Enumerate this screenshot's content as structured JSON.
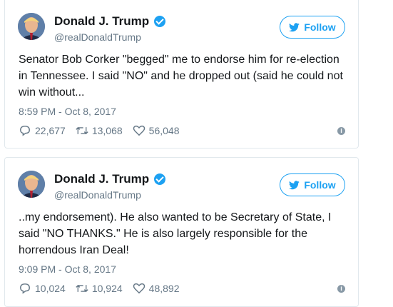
{
  "tweets": [
    {
      "author_name": "Donald J. Trump",
      "handle": "@realDonaldTrump",
      "follow_label": "Follow",
      "text": "Senator Bob Corker \"begged\" me to endorse him for re-election in Tennessee. I said \"NO\" and he dropped out (said he could not win without...",
      "timestamp": "8:59 PM - Oct 8, 2017",
      "replies": "22,677",
      "retweets": "13,068",
      "likes": "56,048"
    },
    {
      "author_name": "Donald J. Trump",
      "handle": "@realDonaldTrump",
      "follow_label": "Follow",
      "text": "..my endorsement). He also wanted to be Secretary of State, I said \"NO THANKS.\" He is also largely responsible for the horrendous Iran Deal!",
      "timestamp": "9:09 PM - Oct 8, 2017",
      "replies": "10,024",
      "retweets": "10,924",
      "likes": "48,892"
    }
  ],
  "icons": {
    "verified": "verified-badge-icon",
    "follow": "twitter-bird-icon",
    "reply": "reply-icon",
    "retweet": "retweet-icon",
    "like": "heart-icon",
    "info": "info-icon"
  },
  "colors": {
    "accent": "#1da1f2",
    "muted": "#657786",
    "text": "#14171a",
    "border": "#e1e8ed"
  }
}
